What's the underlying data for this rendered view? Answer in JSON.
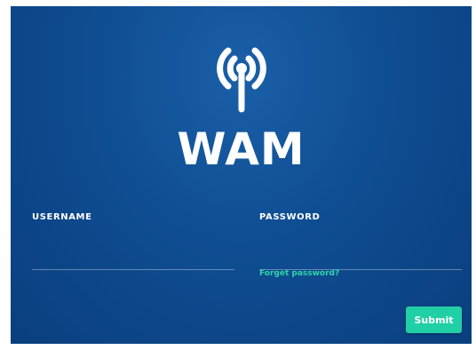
{
  "brand": {
    "name": "WAM",
    "icon": "antenna-broadcast-icon"
  },
  "form": {
    "username": {
      "label": "USERNAME",
      "value": "",
      "placeholder": ""
    },
    "password": {
      "label": "PASSWORD",
      "value": "",
      "placeholder": ""
    },
    "forgot_label": "Forget password?",
    "submit_label": "Submit"
  },
  "colors": {
    "background": "#0f4d92",
    "accent": "#20cfa5",
    "link": "#2ed6a8",
    "text": "#ffffff"
  }
}
